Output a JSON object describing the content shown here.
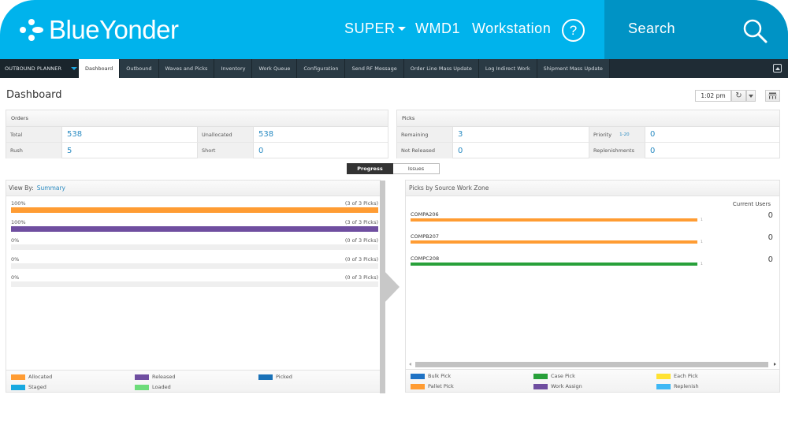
{
  "header": {
    "brand": "BlueYonder",
    "user_menu": "SUPER",
    "warehouse": "WMD1",
    "workstation": "Workstation",
    "help_glyph": "?",
    "search_label": "Search"
  },
  "nav": {
    "module": "OUTBOUND PLANNER",
    "tabs": [
      {
        "label": "Dashboard",
        "active": true
      },
      {
        "label": "Outbound"
      },
      {
        "label": "Waves and Picks"
      },
      {
        "label": "Inventory"
      },
      {
        "label": "Work Queue"
      },
      {
        "label": "Configuration"
      },
      {
        "label": "Send RF Message"
      },
      {
        "label": "Order Line Mass Update"
      },
      {
        "label": "Log Indirect Work"
      },
      {
        "label": "Shipment Mass Update"
      }
    ]
  },
  "page": {
    "title": "Dashboard",
    "time": "1:02 pm"
  },
  "orders": {
    "title": "Orders",
    "rows": [
      {
        "label1": "Total",
        "value1": "538",
        "label2": "Unallocated",
        "value2": "538"
      },
      {
        "label1": "Rush",
        "value1": "5",
        "label2": "Short",
        "value2": "0"
      }
    ]
  },
  "picks": {
    "title": "Picks",
    "rows": [
      {
        "label1": "Remaining",
        "value1": "3",
        "label2": "Priority",
        "range2": "1-20",
        "value2": "0"
      },
      {
        "label1": "Not Released",
        "value1": "0",
        "label2": "Replenishments",
        "value2": "0"
      }
    ]
  },
  "toggle": {
    "progress": "Progress",
    "issues": "Issues",
    "selected": "Progress"
  },
  "progress": {
    "view_by_label": "View By:",
    "view_by_value": "Summary",
    "rows": [
      {
        "status": "Allocated",
        "pct_label": "100%",
        "count_label": "(3 of 3 Picks)",
        "fraction": 1.0,
        "color": "#ff9c33"
      },
      {
        "status": "Released",
        "pct_label": "100%",
        "count_label": "(3 of 3 Picks)",
        "fraction": 1.0,
        "color": "#6f4ea0"
      },
      {
        "status": "Picked",
        "pct_label": "0%",
        "count_label": "(0 of 3 Picks)",
        "fraction": 0.0,
        "color": "#1a72b8"
      },
      {
        "status": "Staged",
        "pct_label": "0%",
        "count_label": "(0 of 3 Picks)",
        "fraction": 0.0,
        "color": "#17a8e0"
      },
      {
        "status": "Loaded",
        "pct_label": "0%",
        "count_label": "(0 of 3 Picks)",
        "fraction": 0.0,
        "color": "#6ddc7a"
      }
    ],
    "legend": [
      {
        "label": "Allocated",
        "color": "#ff9c33"
      },
      {
        "label": "Released",
        "color": "#6f4ea0"
      },
      {
        "label": "Picked",
        "color": "#1a72b8"
      },
      {
        "label": "Staged",
        "color": "#17a8e0"
      },
      {
        "label": "Loaded",
        "color": "#6ddc7a"
      }
    ]
  },
  "zones": {
    "title": "Picks by Source Work Zone",
    "current_users_label": "Current Users",
    "rows": [
      {
        "zone": "COMPA206",
        "picks": "1",
        "color": "#ff9c33",
        "users": "0"
      },
      {
        "zone": "COMPB207",
        "picks": "1",
        "color": "#ff9c33",
        "users": "0"
      },
      {
        "zone": "COMPC208",
        "picks": "1",
        "color": "#28a03a",
        "users": "0"
      }
    ],
    "legend": [
      {
        "label": "Bulk Pick",
        "color": "#1f72c4"
      },
      {
        "label": "Case Pick",
        "color": "#28a03a"
      },
      {
        "label": "Each Pick",
        "color": "#ffe233"
      },
      {
        "label": "Pallet Pick",
        "color": "#ff9c33"
      },
      {
        "label": "Work Assign",
        "color": "#6f4ea0"
      },
      {
        "label": "Replenish",
        "color": "#3fb8f5"
      }
    ]
  }
}
